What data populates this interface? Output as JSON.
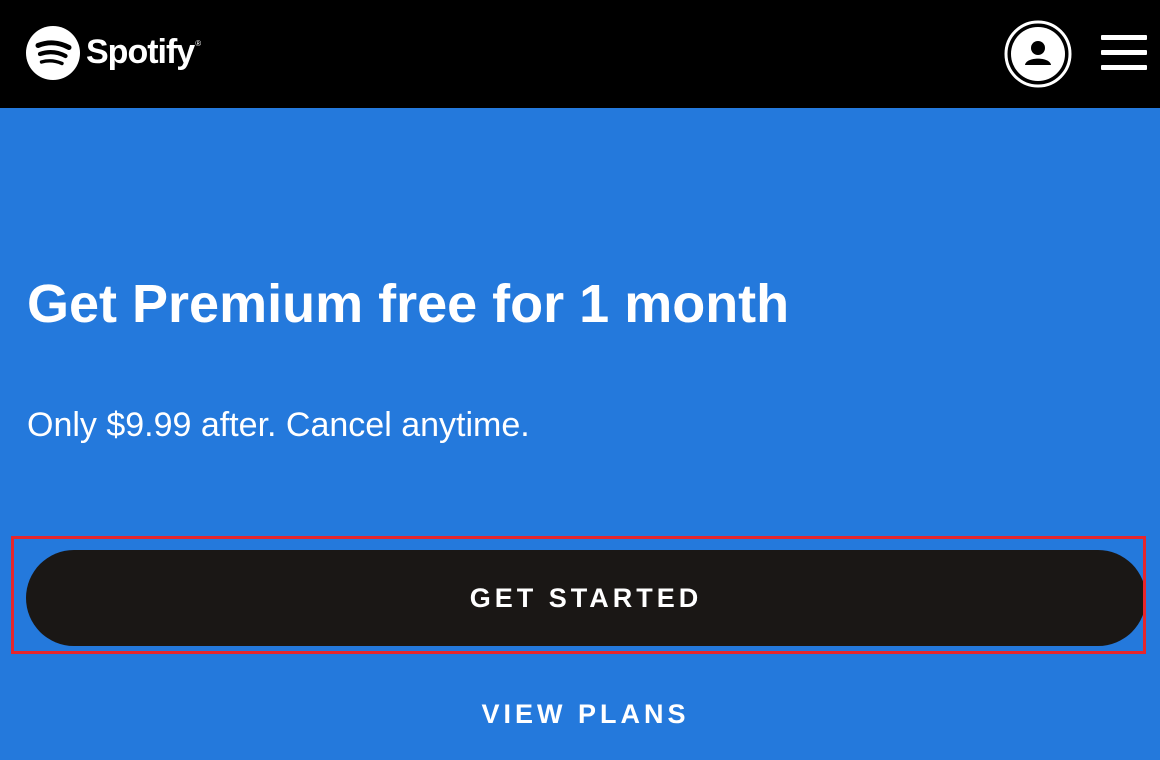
{
  "header": {
    "logo_text": "Spotify",
    "logo_registered": "®",
    "logo_icon": "spotify-logo-icon",
    "profile_icon": "user-icon",
    "menu_icon": "hamburger-menu-icon"
  },
  "hero": {
    "headline": "Get Premium free for 1 month",
    "subline": "Only $9.99 after. Cancel anytime.",
    "primary_button_label": "GET STARTED",
    "secondary_link_label": "VIEW PLANS"
  },
  "colors": {
    "header_bg": "#000000",
    "hero_bg": "#2479dc",
    "button_bg": "#1a1715",
    "text": "#ffffff",
    "highlight": "#e8262b"
  }
}
